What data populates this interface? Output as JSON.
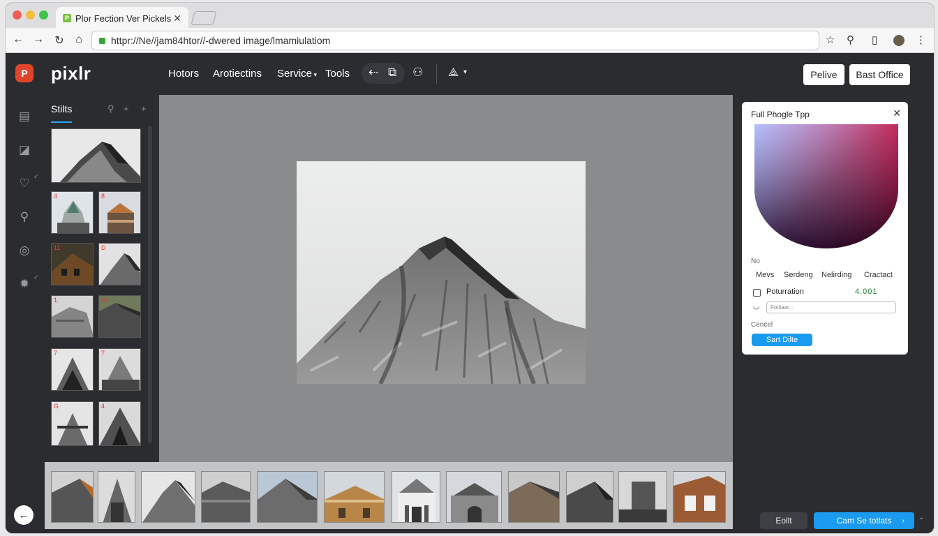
{
  "browser": {
    "tab_title": "Plor Fection Ver Pickels",
    "tab_favicon": "P",
    "url": "httpr://Ne//jam84htor//-dwered image/lmamiulatiom"
  },
  "app": {
    "brand": "pixlr",
    "logo_letter": "P",
    "menu": [
      "Hotors",
      "Arotiectins",
      "Service",
      "Tools"
    ],
    "header_buttons": {
      "left": "Pelive",
      "right": "Bast Office"
    }
  },
  "library": {
    "title": "Stilts",
    "badges": [
      "",
      "4",
      "8",
      "11",
      "D",
      "1",
      "11",
      "7",
      "7",
      "G",
      "4"
    ]
  },
  "panel": {
    "title": "Full Phogle Tpp",
    "label_no": "No",
    "columns": [
      "Mevs",
      "Serdeng",
      "Nelirding",
      "Cractact"
    ],
    "field_label": "Poturration",
    "field_value": "4.001",
    "text_placeholder": "Fotliaar...",
    "cancel": "Cencel",
    "primary": "Sart Dilte"
  },
  "footer": {
    "left_button": "Eollt",
    "right_button": "Cam Se totlats"
  },
  "colors": {
    "accent": "#1a9bf0",
    "logo": "#e0452b",
    "window_bg": "#2b2c30",
    "canvas_bg": "#8a8b8d"
  }
}
